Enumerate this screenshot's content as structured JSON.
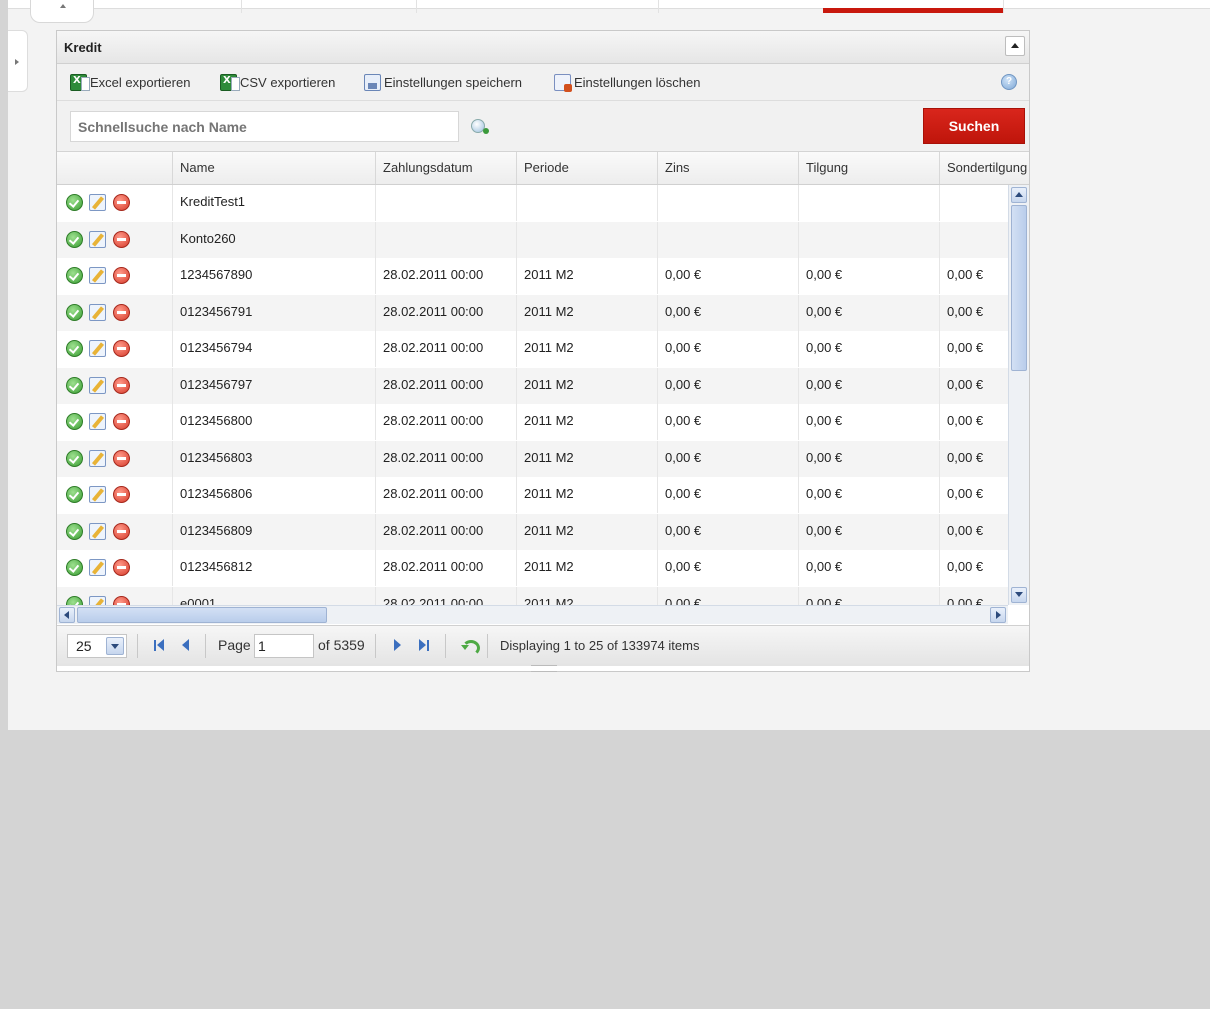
{
  "panel": {
    "title": "Kredit"
  },
  "toolbar": {
    "excel_label": "Excel exportieren",
    "csv_label": "CSV exportieren",
    "save_settings_label": "Einstellungen speichern",
    "delete_settings_label": "Einstellungen löschen",
    "help_symbol": "?"
  },
  "search": {
    "placeholder": "Schnellsuche nach Name",
    "button_label": "Suchen"
  },
  "columns": [
    "Name",
    "Zahlungsdatum",
    "Periode",
    "Zins",
    "Tilgung",
    "Sondertilgung"
  ],
  "rows": [
    {
      "name": "KreditTest1",
      "zahlungsdatum": "",
      "periode": "",
      "zins": "",
      "tilgung": "",
      "sondertilgung": ""
    },
    {
      "name": "Konto260",
      "zahlungsdatum": "",
      "periode": "",
      "zins": "",
      "tilgung": "",
      "sondertilgung": ""
    },
    {
      "name": "1234567890",
      "zahlungsdatum": "28.02.2011 00:00",
      "periode": "2011 M2",
      "zins": "0,00 €",
      "tilgung": "0,00 €",
      "sondertilgung": "0,00 €"
    },
    {
      "name": "0123456791",
      "zahlungsdatum": "28.02.2011 00:00",
      "periode": "2011 M2",
      "zins": "0,00 €",
      "tilgung": "0,00 €",
      "sondertilgung": "0,00 €"
    },
    {
      "name": "0123456794",
      "zahlungsdatum": "28.02.2011 00:00",
      "periode": "2011 M2",
      "zins": "0,00 €",
      "tilgung": "0,00 €",
      "sondertilgung": "0,00 €"
    },
    {
      "name": "0123456797",
      "zahlungsdatum": "28.02.2011 00:00",
      "periode": "2011 M2",
      "zins": "0,00 €",
      "tilgung": "0,00 €",
      "sondertilgung": "0,00 €"
    },
    {
      "name": "0123456800",
      "zahlungsdatum": "28.02.2011 00:00",
      "periode": "2011 M2",
      "zins": "0,00 €",
      "tilgung": "0,00 €",
      "sondertilgung": "0,00 €"
    },
    {
      "name": "0123456803",
      "zahlungsdatum": "28.02.2011 00:00",
      "periode": "2011 M2",
      "zins": "0,00 €",
      "tilgung": "0,00 €",
      "sondertilgung": "0,00 €"
    },
    {
      "name": "0123456806",
      "zahlungsdatum": "28.02.2011 00:00",
      "periode": "2011 M2",
      "zins": "0,00 €",
      "tilgung": "0,00 €",
      "sondertilgung": "0,00 €"
    },
    {
      "name": "0123456809",
      "zahlungsdatum": "28.02.2011 00:00",
      "periode": "2011 M2",
      "zins": "0,00 €",
      "tilgung": "0,00 €",
      "sondertilgung": "0,00 €"
    },
    {
      "name": "0123456812",
      "zahlungsdatum": "28.02.2011 00:00",
      "periode": "2011 M2",
      "zins": "0,00 €",
      "tilgung": "0,00 €",
      "sondertilgung": "0,00 €"
    },
    {
      "name": "e0001",
      "zahlungsdatum": "28.02.2011 00:00",
      "periode": "2011 M2",
      "zins": "0,00 €",
      "tilgung": "0,00 €",
      "sondertilgung": "0,00 €"
    }
  ],
  "pager": {
    "page_size": "25",
    "page_label": "Page",
    "current_page": "1",
    "of_label": "of 5359",
    "display_info": "Displaying 1 to 25 of 133974 items"
  },
  "colors": {
    "accent_red": "#c8180d"
  },
  "icons": {
    "row_actions": [
      "check-icon",
      "edit-icon",
      "delete-icon"
    ],
    "toolbar": [
      "excel-icon",
      "csv-icon",
      "save-settings-icon",
      "delete-settings-icon",
      "help-icon"
    ]
  }
}
